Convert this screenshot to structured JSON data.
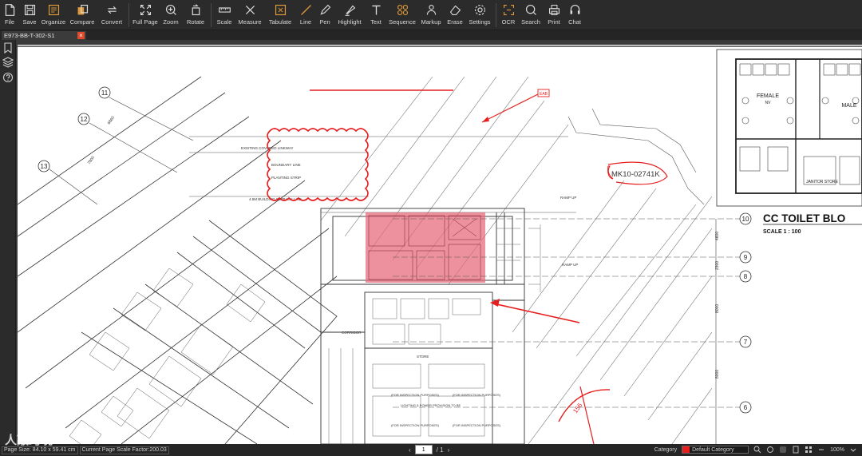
{
  "toolbar": {
    "file": "File",
    "save": "Save",
    "organize": "Organize",
    "compare": "Compare",
    "convert": "Convert",
    "fullpage": "Full Page",
    "zoom": "Zoom",
    "rotate": "Rotate",
    "scale": "Scale",
    "measure": "Measure",
    "tabulate": "Tabulate",
    "line": "Line",
    "pen": "Pen",
    "highlight": "Highlight",
    "text": "Text",
    "sequence": "Sequence",
    "markup": "Markup",
    "erase": "Erase",
    "settings": "Settings",
    "ocr": "OCR",
    "search": "Search",
    "print": "Print",
    "chat": "Chat"
  },
  "colors": {
    "markup_red": "#e61e1e",
    "highlight_fill": "#e8667a",
    "toolbar_bg": "#2b2b2b",
    "accent_orange": "#e09a3a"
  },
  "tab": {
    "title": "E973-BB-T-302-S1",
    "close": "×"
  },
  "drawing": {
    "title": "CC TOILET BLO",
    "scale": "SCALE 1 : 100",
    "grid_labels": [
      "11",
      "12",
      "13",
      "10",
      "9",
      "8",
      "7",
      "6"
    ],
    "dims": [
      "4600",
      "2300",
      "8000",
      "8000",
      "7800",
      "6860"
    ],
    "notes": {
      "linkway": "EXISTING COVERED LINKWAY",
      "boundary": "BOUNDARY LINE",
      "planting": "PLANTING STRIP",
      "setback": "4.5M BUILDING SETBACK LINE",
      "ramp_up": "RAMP UP",
      "ramp_up2": "RAMP UP",
      "female": "FEMALE",
      "male": "MALE",
      "janitor": "JANITOR STORE",
      "store": "STORE",
      "corridor": "CORRIDOR",
      "inspection1": "(FOR INSPECTION PURPOSES)",
      "inspection2": "(FOR INSPECTION PURPOSES)",
      "inspection3": "(FOR INSPECTION PURPOSES)",
      "inspection4": "(FOR INSPECTION PURPOSES)",
      "lighting": "LIGHTING & POWER PROVISION TO BE",
      "mv": "NV"
    },
    "markup_code": "MK10-02741K",
    "markup_angle": "156",
    "callout": "EAB"
  },
  "status": {
    "page_size": "Page Size: 84.10 x 59.41 cm",
    "scale_factor": "Current Page Scale Factor:200.03",
    "current_page": "1",
    "total_pages": "/ 1",
    "category_label": "Category",
    "category_value": "Default Category",
    "zoom": "100%"
  },
  "watermark": "人敲跨境"
}
